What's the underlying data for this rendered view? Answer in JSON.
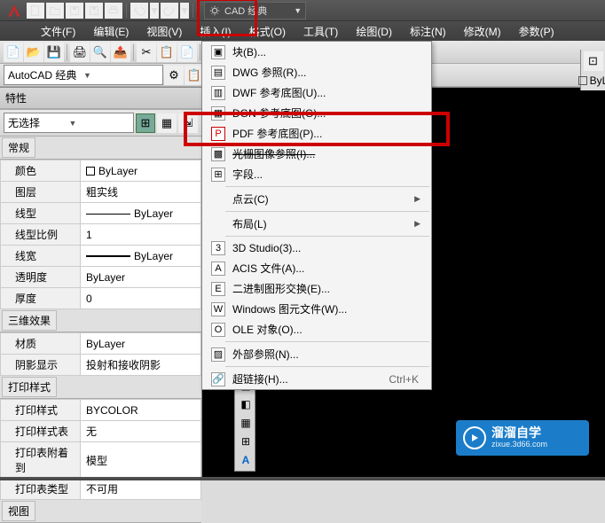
{
  "app": {
    "title_suffix": "CAD 经典",
    "workspace_name": "AutoCAD 经典"
  },
  "menus": {
    "file": "文件(F)",
    "edit": "编辑(E)",
    "view": "视图(V)",
    "insert": "插入(I)",
    "format": "格式(O)",
    "tools": "工具(T)",
    "draw": "绘图(D)",
    "dimension": "标注(N)",
    "modify": "修改(M)",
    "params": "参数(P)"
  },
  "insert_menu": {
    "block": "块(B)...",
    "dwg_ref": "DWG 参照(R)...",
    "dwf_underlay": "DWF 参考底图(U)...",
    "dgn_underlay": "DGN 参考底图(G)...",
    "pdf_underlay": "PDF 参考底图(P)...",
    "raster_ref": "光栅图像参照(I)...",
    "field": "字段...",
    "point_cloud": "点云(C)",
    "layout": "布局(L)",
    "3d_studio": "3D Studio(3)...",
    "acis": "ACIS 文件(A)...",
    "binary_dxf": "二进制图形交换(E)...",
    "wmf": "Windows 图元文件(W)...",
    "ole": "OLE 对象(O)...",
    "xref": "外部参照(N)...",
    "hyperlink": "超链接(H)...",
    "hyperlink_shortcut": "Ctrl+K"
  },
  "properties": {
    "title": "特性",
    "selection": "无选择",
    "sections": {
      "general": "常规",
      "effects3d": "三维效果",
      "print_style": "打印样式",
      "view": "视图"
    },
    "rows": {
      "color": {
        "label": "颜色",
        "value": "ByLayer"
      },
      "layer": {
        "label": "图层",
        "value": "粗实线"
      },
      "linetype": {
        "label": "线型",
        "value": "ByLayer"
      },
      "linetype_scale": {
        "label": "线型比例",
        "value": "1"
      },
      "lineweight": {
        "label": "线宽",
        "value": "ByLayer"
      },
      "transparency": {
        "label": "透明度",
        "value": "ByLayer"
      },
      "thickness": {
        "label": "厚度",
        "value": "0"
      },
      "material": {
        "label": "材质",
        "value": "ByLayer"
      },
      "shadow": {
        "label": "阴影显示",
        "value": "投射和接收阴影"
      },
      "plot_style": {
        "label": "打印样式",
        "value": "BYCOLOR"
      },
      "plot_table": {
        "label": "打印样式表",
        "value": "无"
      },
      "plot_attached": {
        "label": "打印表附着到",
        "value": "模型"
      },
      "plot_type": {
        "label": "打印表类型",
        "value": "不可用"
      }
    }
  },
  "right": {
    "bylayer_check": "ByL"
  },
  "watermark": {
    "zh": "溜溜自学",
    "url": "zixue.3d66.com"
  }
}
